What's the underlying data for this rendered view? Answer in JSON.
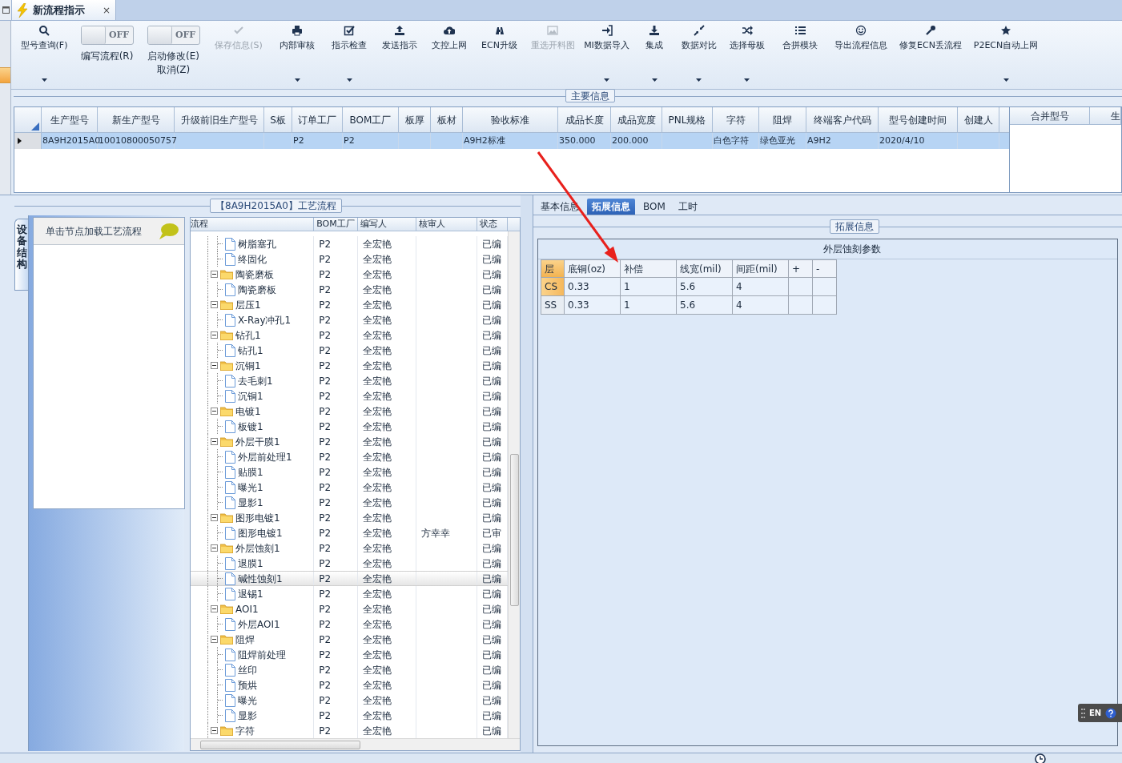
{
  "tab": {
    "title": "新流程指示",
    "close": "×"
  },
  "toolbar": {
    "items": [
      {
        "kind": "button",
        "labels": [
          "型号查询(F)"
        ],
        "dropdown": true,
        "disabled": false
      },
      {
        "kind": "toggle",
        "labels": [
          "编写流程(R)"
        ],
        "toggle_text": "OFF",
        "on": false
      },
      {
        "kind": "toggle",
        "labels": [
          "启动修改(E)",
          "取消(Z)"
        ],
        "toggle_text": "OFF",
        "on": false
      },
      {
        "kind": "button",
        "labels": [
          "保存信息(S)"
        ],
        "dropdown": false,
        "disabled": true
      },
      {
        "kind": "button",
        "labels": [
          "内部审核"
        ],
        "dropdown": true,
        "disabled": false
      },
      {
        "kind": "button",
        "labels": [
          "指示检查"
        ],
        "dropdown": true,
        "disabled": false
      },
      {
        "kind": "button",
        "labels": [
          "发送指示"
        ],
        "dropdown": false,
        "disabled": false
      },
      {
        "kind": "button",
        "labels": [
          "文控上网"
        ],
        "dropdown": false,
        "disabled": false
      },
      {
        "kind": "button",
        "labels": [
          "ECN升级"
        ],
        "dropdown": false,
        "disabled": false
      },
      {
        "kind": "button",
        "labels": [
          "重选开料图"
        ],
        "dropdown": false,
        "disabled": true
      },
      {
        "kind": "button",
        "labels": [
          "MI数据导入"
        ],
        "dropdown": true,
        "disabled": false
      },
      {
        "kind": "button",
        "labels": [
          "集成"
        ],
        "dropdown": true,
        "disabled": false
      },
      {
        "kind": "button",
        "labels": [
          "数据对比"
        ],
        "dropdown": true,
        "disabled": false
      },
      {
        "kind": "button",
        "labels": [
          "选择母板"
        ],
        "dropdown": true,
        "disabled": false
      },
      {
        "kind": "button",
        "labels": [
          "合拼模块"
        ],
        "dropdown": false,
        "disabled": false
      },
      {
        "kind": "button",
        "labels": [
          "导出流程信息"
        ],
        "dropdown": false,
        "disabled": false
      },
      {
        "kind": "button",
        "labels": [
          "修复ECN丢流程"
        ],
        "dropdown": false,
        "disabled": false
      },
      {
        "kind": "button",
        "labels": [
          "P2ECN自动上网"
        ],
        "dropdown": true,
        "disabled": false
      }
    ]
  },
  "main_info": {
    "title": "主要信息",
    "table": {
      "columns": [
        "生产型号",
        "新生产型号",
        "升级前旧生产型号",
        "S板",
        "订单工厂",
        "BOM工厂",
        "板厚",
        "板材",
        "验收标准",
        "成品长度",
        "成品宽度",
        "PNL规格",
        "字符",
        "阻焊",
        "终端客户代码",
        "型号创建时间",
        "创建人"
      ],
      "rows": [
        {
          "selected": true,
          "cells": [
            "8A9H2015A0",
            "10010800050757",
            null,
            null,
            "P2",
            "P2",
            null,
            null,
            "A9H2标准",
            "350.000",
            "200.000",
            null,
            "白色字符",
            "绿色亚光",
            "A9H2",
            "2020/4/10",
            null
          ]
        }
      ]
    },
    "merge_table": {
      "columns": [
        "合并型号",
        "生"
      ]
    }
  },
  "flow_panel": {
    "title": "【8A9H2015A0】工艺流程",
    "side_tab": "设备结构",
    "hint": "单击节点加载工艺流程",
    "tree": {
      "columns": [
        "流程",
        "BOM工厂",
        "编写人",
        "核审人",
        "状态"
      ],
      "items": [
        {
          "kind": "continued",
          "children": [
            {
              "label": "树脂塞孔",
              "bom": "P2",
              "writer": "全宏艳",
              "status": "已编",
              "selected": false
            },
            {
              "label": "终固化",
              "bom": "P2",
              "writer": "全宏艳",
              "status": "已编",
              "selected": false
            }
          ]
        },
        {
          "kind": "folder",
          "label": "陶瓷磨板",
          "bom": "P2",
          "writer": "全宏艳",
          "status": "已编",
          "selected": false,
          "expanded": true,
          "children": [
            {
              "label": "陶瓷磨板",
              "bom": "P2",
              "writer": "全宏艳",
              "status": "已编",
              "selected": false
            }
          ]
        },
        {
          "kind": "folder",
          "label": "层压1",
          "bom": "P2",
          "writer": "全宏艳",
          "status": "已编",
          "selected": false,
          "expanded": true,
          "children": [
            {
              "label": "X-Ray冲孔1",
              "bom": "P2",
              "writer": "全宏艳",
              "status": "已编",
              "selected": false
            }
          ]
        },
        {
          "kind": "folder",
          "label": "钻孔1",
          "bom": "P2",
          "writer": "全宏艳",
          "status": "已编",
          "selected": false,
          "expanded": true,
          "children": [
            {
              "label": "钻孔1",
              "bom": "P2",
              "writer": "全宏艳",
              "status": "已编",
              "selected": false
            }
          ]
        },
        {
          "kind": "folder",
          "label": "沉铜1",
          "bom": "P2",
          "writer": "全宏艳",
          "status": "已编",
          "selected": false,
          "expanded": true,
          "children": [
            {
              "label": "去毛刺1",
              "bom": "P2",
              "writer": "全宏艳",
              "status": "已编",
              "selected": false
            },
            {
              "label": "沉铜1",
              "bom": "P2",
              "writer": "全宏艳",
              "status": "已编",
              "selected": false
            }
          ]
        },
        {
          "kind": "folder",
          "label": "电镀1",
          "bom": "P2",
          "writer": "全宏艳",
          "status": "已编",
          "selected": false,
          "expanded": true,
          "children": [
            {
              "label": "板镀1",
              "bom": "P2",
              "writer": "全宏艳",
              "status": "已编",
              "selected": false
            }
          ]
        },
        {
          "kind": "folder",
          "label": "外层干膜1",
          "bom": "P2",
          "writer": "全宏艳",
          "status": "已编",
          "selected": false,
          "expanded": true,
          "children": [
            {
              "label": "外层前处理1",
              "bom": "P2",
              "writer": "全宏艳",
              "status": "已编",
              "selected": false
            },
            {
              "label": "贴膜1",
              "bom": "P2",
              "writer": "全宏艳",
              "status": "已编",
              "selected": false
            },
            {
              "label": "曝光1",
              "bom": "P2",
              "writer": "全宏艳",
              "status": "已编",
              "selected": false
            },
            {
              "label": "显影1",
              "bom": "P2",
              "writer": "全宏艳",
              "status": "已编",
              "selected": false
            }
          ]
        },
        {
          "kind": "folder",
          "label": "图形电镀1",
          "bom": "P2",
          "writer": "全宏艳",
          "status": "已编",
          "selected": false,
          "expanded": true,
          "children": [
            {
              "label": "图形电镀1",
              "bom": "P2",
              "writer": "全宏艳",
              "reviewer": "方幸幸",
              "status": "已审",
              "selected": false
            }
          ]
        },
        {
          "kind": "folder",
          "label": "外层蚀刻1",
          "bom": "P2",
          "writer": "全宏艳",
          "status": "已编",
          "selected": false,
          "expanded": true,
          "children": [
            {
              "label": "退膜1",
              "bom": "P2",
              "writer": "全宏艳",
              "status": "已编",
              "selected": false
            },
            {
              "label": "碱性蚀刻1",
              "bom": "P2",
              "writer": "全宏艳",
              "status": "已编",
              "selected": true
            },
            {
              "label": "退锡1",
              "bom": "P2",
              "writer": "全宏艳",
              "status": "已编",
              "selected": false
            }
          ]
        },
        {
          "kind": "folder",
          "label": "AOI1",
          "bom": "P2",
          "writer": "全宏艳",
          "status": "已编",
          "selected": false,
          "expanded": true,
          "children": [
            {
              "label": "外层AOI1",
              "bom": "P2",
              "writer": "全宏艳",
              "status": "已编",
              "selected": false
            }
          ]
        },
        {
          "kind": "folder",
          "label": "阻焊",
          "bom": "P2",
          "writer": "全宏艳",
          "status": "已编",
          "selected": false,
          "expanded": true,
          "children": [
            {
              "label": "阻焊前处理",
              "bom": "P2",
              "writer": "全宏艳",
              "status": "已编",
              "selected": false
            },
            {
              "label": "丝印",
              "bom": "P2",
              "writer": "全宏艳",
              "status": "已编",
              "selected": false
            },
            {
              "label": "预烘",
              "bom": "P2",
              "writer": "全宏艳",
              "status": "已编",
              "selected": false
            },
            {
              "label": "曝光",
              "bom": "P2",
              "writer": "全宏艳",
              "status": "已编",
              "selected": false
            },
            {
              "label": "显影",
              "bom": "P2",
              "writer": "全宏艳",
              "status": "已编",
              "selected": false
            }
          ]
        },
        {
          "kind": "folder",
          "label": "字符",
          "bom": "P2",
          "writer": "全宏艳",
          "status": "已编",
          "selected": false,
          "expanded": true
        }
      ]
    }
  },
  "detail_panel": {
    "tabs": [
      {
        "label": "基本信息",
        "selected": false
      },
      {
        "label": "拓展信息",
        "selected": true
      },
      {
        "label": "BOM",
        "selected": false
      },
      {
        "label": "工时",
        "selected": false
      }
    ],
    "group_title": "拓展信息",
    "section_title": "外层蚀刻参数",
    "grid": {
      "columns": [
        "层",
        "底铜(oz)",
        "补偿",
        "线宽(mil)",
        "间距(mil)",
        "+",
        "-"
      ],
      "rows": [
        {
          "selected": true,
          "cells": [
            "CS",
            "0.33",
            "1",
            "5.6",
            "4",
            null,
            null
          ]
        },
        {
          "selected": false,
          "cells": [
            "SS",
            "0.33",
            "1",
            "5.6",
            "4",
            null,
            null
          ]
        }
      ]
    }
  },
  "language_bar": {
    "label": "EN"
  }
}
